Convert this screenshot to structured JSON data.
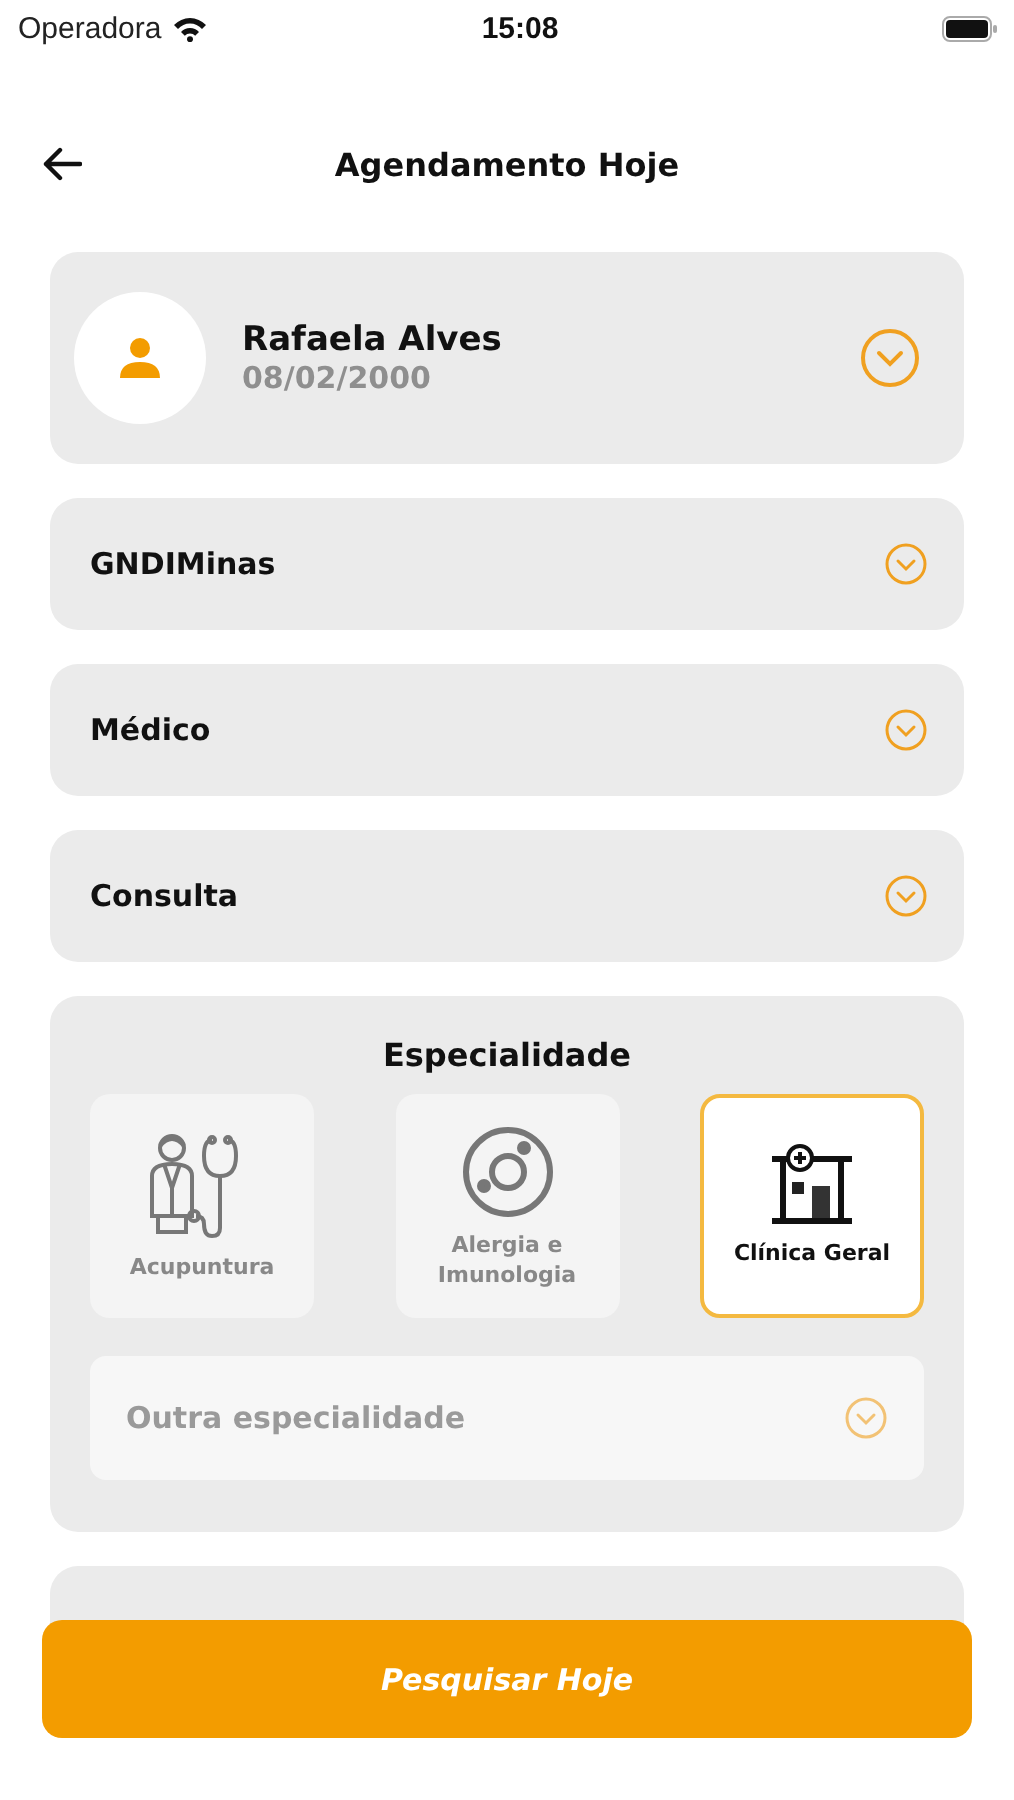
{
  "status_bar": {
    "carrier": "Operadora",
    "time": "15:08"
  },
  "header": {
    "title": "Agendamento Hoje"
  },
  "patient": {
    "name": "Rafaela Alves",
    "birth_date": "08/02/2000"
  },
  "selects": [
    {
      "label": "GNDIMinas"
    },
    {
      "label": "Médico"
    },
    {
      "label": "Consulta"
    }
  ],
  "specialty": {
    "title": "Especialidade",
    "options": [
      {
        "kind": "doctor",
        "label": "Acupuntura",
        "selected": false
      },
      {
        "kind": "allergy",
        "label": "Alergia e Imunologia",
        "selected": false
      },
      {
        "kind": "clinic",
        "label": "Clínica Geral",
        "selected": true
      }
    ],
    "other": {
      "placeholder": "Outra especialidade",
      "disabled": true
    }
  },
  "search_button": {
    "label": "Pesquisar Hoje"
  }
}
